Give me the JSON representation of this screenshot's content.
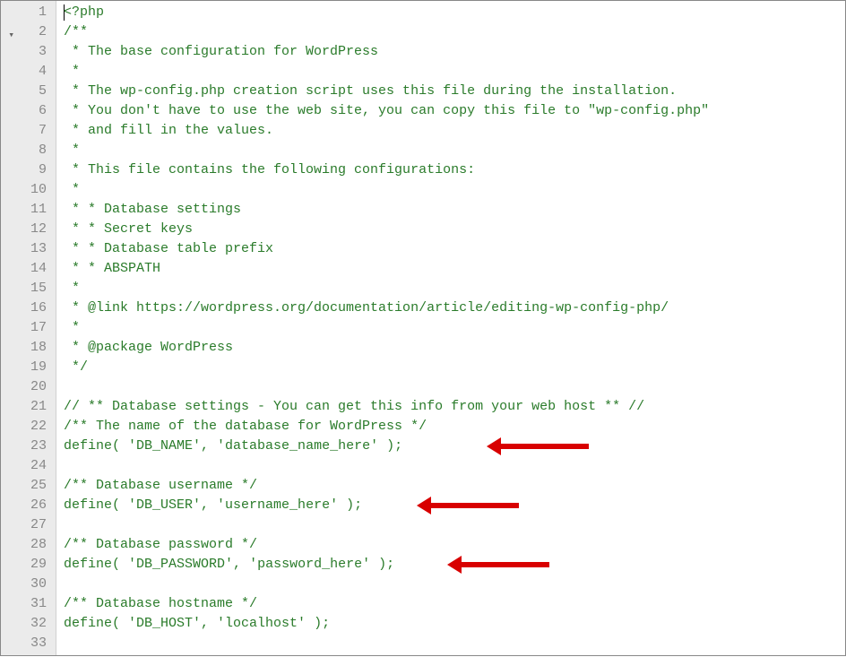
{
  "lines": {
    "1": "<?php",
    "2": "/**",
    "3": " * The base configuration for WordPress",
    "4": " *",
    "5": " * The wp-config.php creation script uses this file during the installation.",
    "6": " * You don't have to use the web site, you can copy this file to \"wp-config.php\"",
    "7": " * and fill in the values.",
    "8": " *",
    "9": " * This file contains the following configurations:",
    "10": " *",
    "11": " * * Database settings",
    "12": " * * Secret keys",
    "13": " * * Database table prefix",
    "14": " * * ABSPATH",
    "15": " *",
    "16": " * @link https://wordpress.org/documentation/article/editing-wp-config-php/",
    "17": " *",
    "18": " * @package WordPress",
    "19": " */",
    "20": "",
    "21": "// ** Database settings - You can get this info from your web host ** //",
    "22": "/** The name of the database for WordPress */",
    "23a": "define( ",
    "23b": "'DB_NAME'",
    "23c": ", ",
    "23d": "'database_name_here'",
    "23e": " );",
    "24": "",
    "25": "/** Database username */",
    "26a": "define( ",
    "26b": "'DB_USER'",
    "26c": ", ",
    "26d": "'username_here'",
    "26e": " );",
    "27": "",
    "28": "/** Database password */",
    "29a": "define( ",
    "29b": "'DB_PASSWORD'",
    "29c": ", ",
    "29d": "'password_here'",
    "29e": " );",
    "30": "",
    "31": "/** Database hostname */",
    "32a": "define( ",
    "32b": "'DB_HOST'",
    "32c": ", ",
    "32d": "'localhost'",
    "32e": " );",
    "33": ""
  },
  "nums": {
    "1": "1",
    "2": "2",
    "3": "3",
    "4": "4",
    "5": "5",
    "6": "6",
    "7": "7",
    "8": "8",
    "9": "9",
    "10": "10",
    "11": "11",
    "12": "12",
    "13": "13",
    "14": "14",
    "15": "15",
    "16": "16",
    "17": "17",
    "18": "18",
    "19": "19",
    "20": "20",
    "21": "21",
    "22": "22",
    "23": "23",
    "24": "24",
    "25": "25",
    "26": "26",
    "27": "27",
    "28": "28",
    "29": "29",
    "30": "30",
    "31": "31",
    "32": "32",
    "33": "33"
  },
  "fold_marker": "▾",
  "fold_marker_alt": "▼"
}
